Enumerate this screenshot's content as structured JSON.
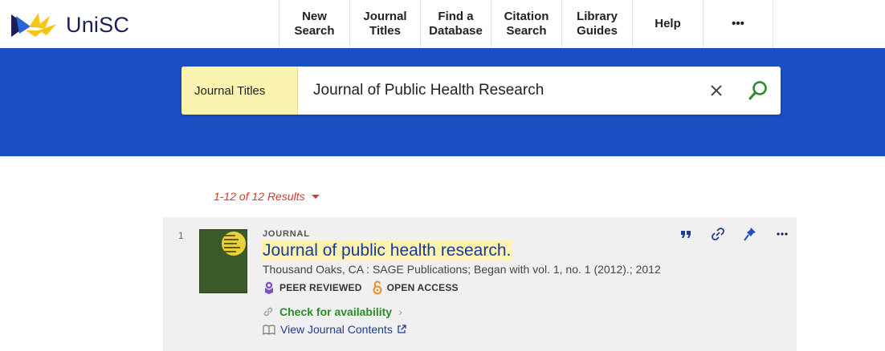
{
  "header": {
    "logo_text": "UniSC",
    "nav": [
      {
        "label": "New\nSearch"
      },
      {
        "label": "Journal\nTitles"
      },
      {
        "label": "Find a\nDatabase"
      },
      {
        "label": "Citation\nSearch"
      },
      {
        "label": "Library\nGuides"
      },
      {
        "label": "Help"
      },
      {
        "label": "•••"
      }
    ]
  },
  "search": {
    "scope": "Journal Titles",
    "query": "Journal of Public Health Research"
  },
  "results": {
    "count_label": "1-12 of 12 Results"
  },
  "record": {
    "number": "1",
    "type": "JOURNAL",
    "title": "Journal of public health research.",
    "publication": "Thousand Oaks, CA : SAGE Publications; Began with vol. 1, no. 1 (2012).; 2012",
    "badge_peer": "PEER REVIEWED",
    "badge_open": "OPEN ACCESS",
    "availability": "Check for availability",
    "view_contents": "View Journal Contents"
  },
  "colors": {
    "brand_blue": "#1d4fc4",
    "scope_yellow": "#fbf3b0",
    "result_red": "#d03a2f",
    "link_blue": "#1b3a94",
    "avail_green": "#2b8a2b",
    "peer_purple": "#7e4fc9",
    "open_orange": "#f08a24"
  }
}
